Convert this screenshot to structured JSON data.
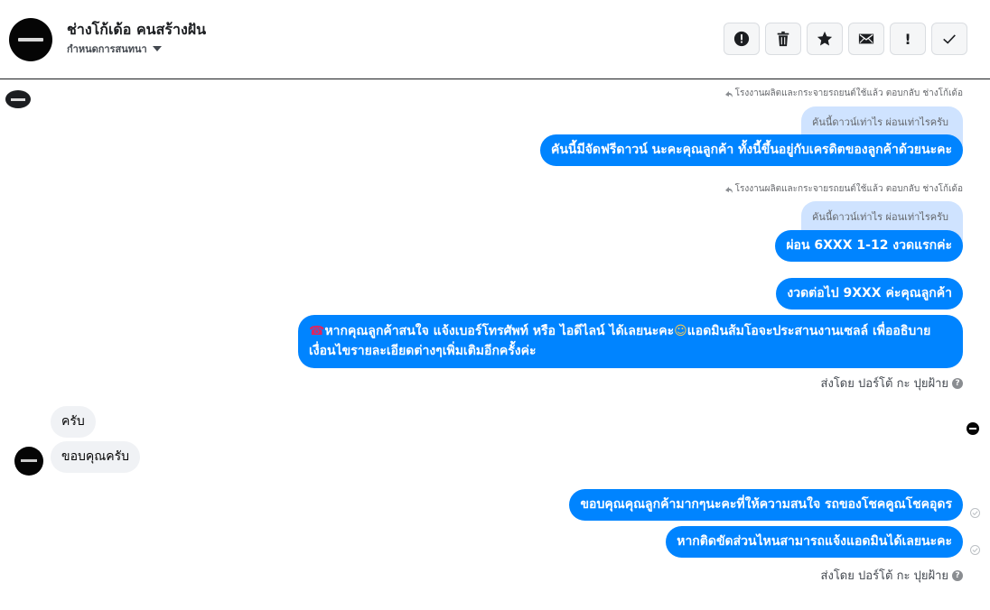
{
  "header": {
    "title": "ช่างโก้เด้อ คนสร้างฝัน",
    "subtitle": "กำหนดการสนทนา",
    "toolbar": {
      "icons": [
        "alert-circle-icon",
        "trash-icon",
        "star-icon",
        "mail-icon",
        "exclamation-icon",
        "check-icon"
      ],
      "exclamation_label": "!"
    }
  },
  "conversation": {
    "reply_note_1": "โรงงานผลิตและกระจายรถยนต์ใช้แล้ว ตอบกลับ ช่างโก้เด้อ",
    "quoted_1": "คันนี้ดาวน์เท่าไร ผ่อนเท่าไรครับ",
    "msg_1": "คันนี้มีจัดฟรีดาวน์ นะคะคุณลูกค้า  ทั้งนี้ขึ้นอยู่กับเครดิตของลูกค้าด้วยนะคะ",
    "reply_note_2": "โรงงานผลิตและกระจายรถยนต์ใช้แล้ว ตอบกลับ ช่างโก้เด้อ",
    "quoted_2": "คันนี้ดาวน์เท่าไร ผ่อนเท่าไรครับ",
    "msg_2": "ผ่อน 6XXX  1-12 งวดแรกค่ะ",
    "msg_3": "งวดต่อไป 9XXX ค่ะคุณลูกค้า",
    "msg_4_emoji_phone": "☎",
    "msg_4_part1": "หากคุณลูกค้าสนใจ แจ้งเบอร์โทรศัพท์ หรือ ไอดีไลน์  ได้เลยนะคะ",
    "msg_4_emoji_face": "☺",
    "msg_4_part2": "แอดมินส้มโอจะประสานงานเซลล์   เพื่ออธิบายเงื่อนไขรายละเอียดต่างๆเพิ่มเติมอีกครั้งค่ะ",
    "sent_by_1": "ส่งโดย ปอร์โต้ กะ ปุยฝ้าย",
    "incoming_1": "ครับ",
    "incoming_2": "ขอบคุณครับ",
    "msg_5": "ขอบคุณคุณลูกค้ามากๆนะคะที่ให้ความสนใจ รถของโชคคูณโชคอุดร",
    "msg_6": "หากติดขัดส่วนไหนสามารถแจ้งแอดมินได้เลยนะคะ",
    "sent_by_2": "ส่งโดย ปอร์โต้ กะ ปุยฝ้าย",
    "help_mark": "?"
  }
}
